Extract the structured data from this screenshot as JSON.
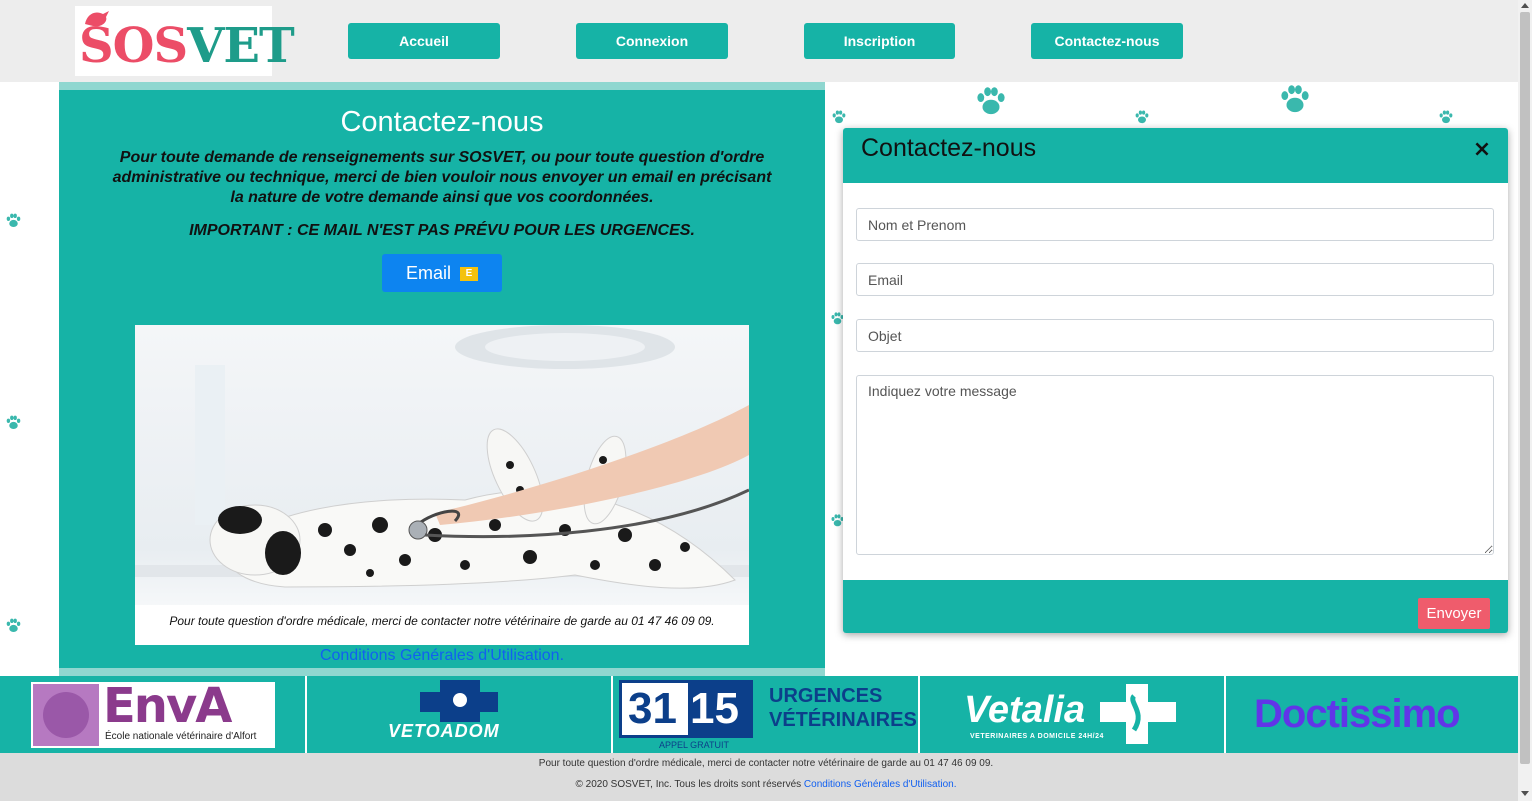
{
  "brand": {
    "logo_sos": "SOS",
    "logo_vet": "VET"
  },
  "nav": [
    {
      "label": "Accueil"
    },
    {
      "label": "Connexion"
    },
    {
      "label": "Inscription"
    },
    {
      "label": "Contactez-nous"
    }
  ],
  "contact": {
    "title": "Contactez-nous",
    "intro": "Pour toute demande de renseignements sur SOSVET, ou pour toute question d'ordre administrative ou technique, merci de bien vouloir nous envoyer un email en précisant la nature de votre demande ainsi que vos coordonnées.",
    "important": "IMPORTANT : CE MAIL N'EST PAS PRÉVU POUR LES URGENCES.",
    "email_button": "Email",
    "email_icon": "E",
    "photo_caption": "Pour toute question d'ordre médicale, merci de contacter notre vétérinaire de garde au 01 47 46 09 09.",
    "cgu_link": "Conditions Générales d'Utilisation."
  },
  "modal": {
    "title": "Contactez-nous",
    "close_icon": "×",
    "name_placeholder": "Nom et Prenom",
    "email_placeholder": "Email",
    "subject_placeholder": "Objet",
    "message_placeholder": "Indiquez votre message",
    "submit_label": "Envoyer"
  },
  "partners": {
    "enva": {
      "name": "EnvA",
      "subtitle": "École nationale vétérinaire d'Alfort"
    },
    "vetoadom": {
      "name": "VETOADOM"
    },
    "urgences": {
      "number_a": "31",
      "number_b": "15",
      "line1": "URGENCES",
      "line2": "VÉTÉRINAIRES",
      "tag": "APPEL GRATUIT"
    },
    "vetalia": {
      "name": "Vetalia",
      "tagline": "VETERINAIRES A DOMICILE 24H/24"
    },
    "doctissimo": {
      "name": "Doctissimo"
    }
  },
  "footer": {
    "line1": "Pour toute question d'ordre médicale, merci de contacter notre vétérinaire de garde au 01 47 46 09 09.",
    "copyright": "© 2020 SOSVET, Inc. Tous les droits sont réservés",
    "cgu_link": "Conditions Générales d'Utilisation."
  },
  "colors": {
    "teal": "#16b3a6",
    "brand_red": "#ec4d67",
    "brand_green": "#1e9c8a",
    "email_blue": "#0d84f0",
    "send_red": "#ef5c6c",
    "link_blue": "#1160f0"
  }
}
